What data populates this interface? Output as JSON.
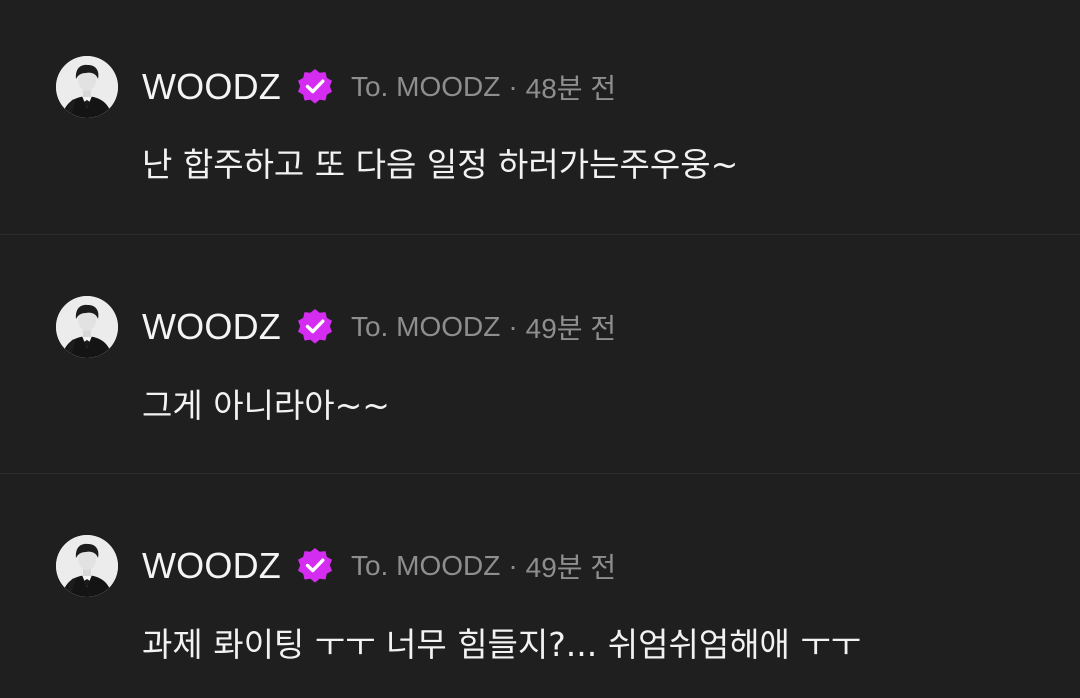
{
  "colors": {
    "background": "#1f1f1f",
    "text": "#f2f2f2",
    "meta": "#8e8e8e",
    "badge": "#d42cf0"
  },
  "posts": [
    {
      "author": "WOODZ",
      "verified_icon": "verified-badge-icon",
      "recipient": "To. MOODZ",
      "separator": "·",
      "time": "48분 전",
      "message": "난 합주하고 또 다음 일정 하러가는주우웅~"
    },
    {
      "author": "WOODZ",
      "verified_icon": "verified-badge-icon",
      "recipient": "To. MOODZ",
      "separator": "·",
      "time": "49분 전",
      "message": "그게 아니라아~~"
    },
    {
      "author": "WOODZ",
      "verified_icon": "verified-badge-icon",
      "recipient": "To. MOODZ",
      "separator": "·",
      "time": "49분 전",
      "message": "과제 롸이팅 ㅜㅜ 너무 힘들지?... 쉬엄쉬엄해애 ㅜㅜ"
    }
  ]
}
